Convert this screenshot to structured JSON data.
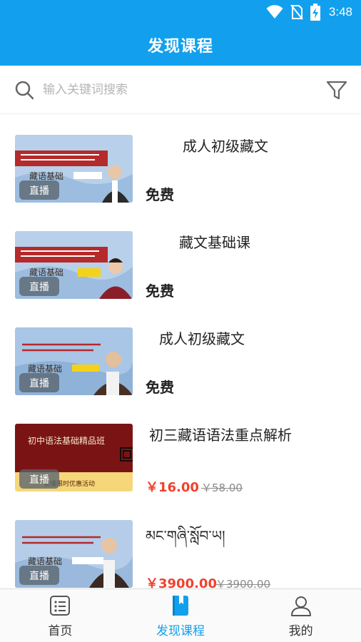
{
  "status": {
    "time": "3:48"
  },
  "header": {
    "title": "发现课程"
  },
  "search": {
    "placeholder": "输入关键词搜索"
  },
  "courses": [
    {
      "title": "成人初级藏文",
      "badge": "直播",
      "price": "免费",
      "banner": "藏语基础"
    },
    {
      "title": "藏文基础课",
      "badge": "直播",
      "price": "免费",
      "banner": "藏语基础"
    },
    {
      "title": "成人初级藏文",
      "badge": "直播",
      "price": "免费",
      "banner": "藏语基础"
    },
    {
      "title": "初三藏语语法重点解析",
      "badge": "直播",
      "price": "￥16.00",
      "original_price": "￥58.00",
      "banner": "初中语法基础精品班",
      "banner_sub": "直播限时优惠活动"
    },
    {
      "title": "མང་གཞི་སློབ་ཡ།",
      "badge": "直播",
      "price": "￥3900.00",
      "original_price": "￥3900.00",
      "banner": "藏语基础"
    }
  ],
  "tabs": [
    {
      "label": "首页",
      "icon": "list-icon",
      "active": false
    },
    {
      "label": "发现课程",
      "icon": "bookmark-book-icon",
      "active": true
    },
    {
      "label": "我的",
      "icon": "person-icon",
      "active": false
    }
  ],
  "colors": {
    "primary": "#12a0ee",
    "price": "#f1412d",
    "banner_red": "#b52a2a"
  }
}
